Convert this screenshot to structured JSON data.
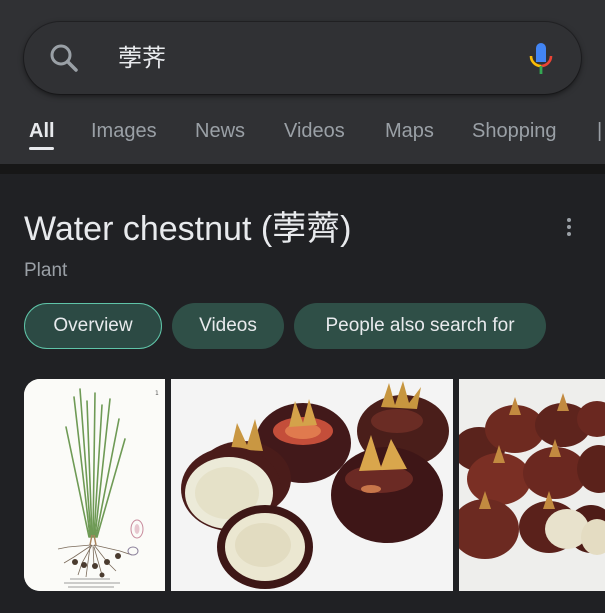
{
  "search": {
    "query": "荸荠"
  },
  "tabs": [
    {
      "label": "All",
      "active": true
    },
    {
      "label": "Images",
      "active": false
    },
    {
      "label": "News",
      "active": false
    },
    {
      "label": "Videos",
      "active": false
    },
    {
      "label": "Maps",
      "active": false
    },
    {
      "label": "Shopping",
      "active": false
    }
  ],
  "knowledge_panel": {
    "title": "Water chestnut (荸薺)",
    "subtitle": "Plant",
    "chips": [
      {
        "label": "Overview",
        "selected": true
      },
      {
        "label": "Videos",
        "selected": false
      },
      {
        "label": "People also search for",
        "selected": false
      }
    ],
    "images": [
      {
        "icon": "botanical-illustration-image"
      },
      {
        "icon": "water-chestnut-halves-image"
      },
      {
        "icon": "water-chestnut-pile-image"
      }
    ]
  },
  "colors": {
    "background": "#202124",
    "header": "#303134",
    "chip": "#2f4f47",
    "chip_border_selected": "#5fc4a8",
    "text_primary": "#e8eaed",
    "text_secondary": "#9aa0a6"
  }
}
